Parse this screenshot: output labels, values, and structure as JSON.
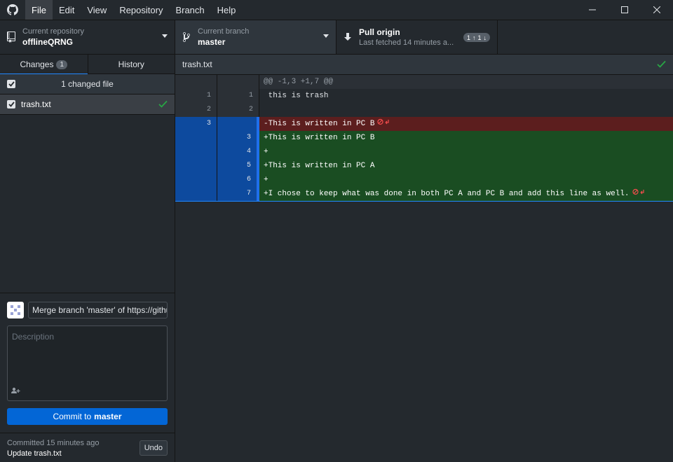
{
  "menu": [
    "File",
    "Edit",
    "View",
    "Repository",
    "Branch",
    "Help"
  ],
  "toolbar": {
    "repo_label": "Current repository",
    "repo_value": "offlineQRNG",
    "branch_label": "Current branch",
    "branch_value": "master",
    "pull_label": "Pull origin",
    "pull_sub": "Last fetched 14 minutes a...",
    "ahead": "1",
    "behind": "1"
  },
  "tabs": {
    "changes": "Changes",
    "changes_count": "1",
    "history": "History"
  },
  "changes": {
    "header": "1 changed file",
    "files": [
      {
        "name": "trash.txt"
      }
    ]
  },
  "commit": {
    "summary": "Merge branch 'master' of https://github",
    "description_placeholder": "Description",
    "button_prefix": "Commit to",
    "button_branch": "master"
  },
  "last_commit": {
    "time": "Committed 15 minutes ago",
    "message": "Update trash.txt",
    "undo": "Undo"
  },
  "diff": {
    "file": "trash.txt",
    "lines": [
      {
        "type": "hunk",
        "old": "",
        "new": "",
        "text": "@@ -1,3 +1,7 @@"
      },
      {
        "type": "context",
        "old": "1",
        "new": "1",
        "text": " this is trash"
      },
      {
        "type": "context",
        "old": "2",
        "new": "2",
        "text": ""
      },
      {
        "type": "del",
        "old": "3",
        "new": "",
        "text": "-This is written in PC B",
        "noeol": true
      },
      {
        "type": "add",
        "old": "",
        "new": "3",
        "text": "+This is written in PC B"
      },
      {
        "type": "add",
        "old": "",
        "new": "4",
        "text": "+"
      },
      {
        "type": "add",
        "old": "",
        "new": "5",
        "text": "+This is written in PC A"
      },
      {
        "type": "add",
        "old": "",
        "new": "6",
        "text": "+"
      },
      {
        "type": "add",
        "old": "",
        "new": "7",
        "text": "+I chose to keep what was done in both PC A and PC B and add this line as well.",
        "noeol": true
      }
    ]
  },
  "colors": {
    "accent": "#0366d6",
    "added": "#1a4d22",
    "deleted": "#5c1e1e",
    "check": "#28a745"
  }
}
